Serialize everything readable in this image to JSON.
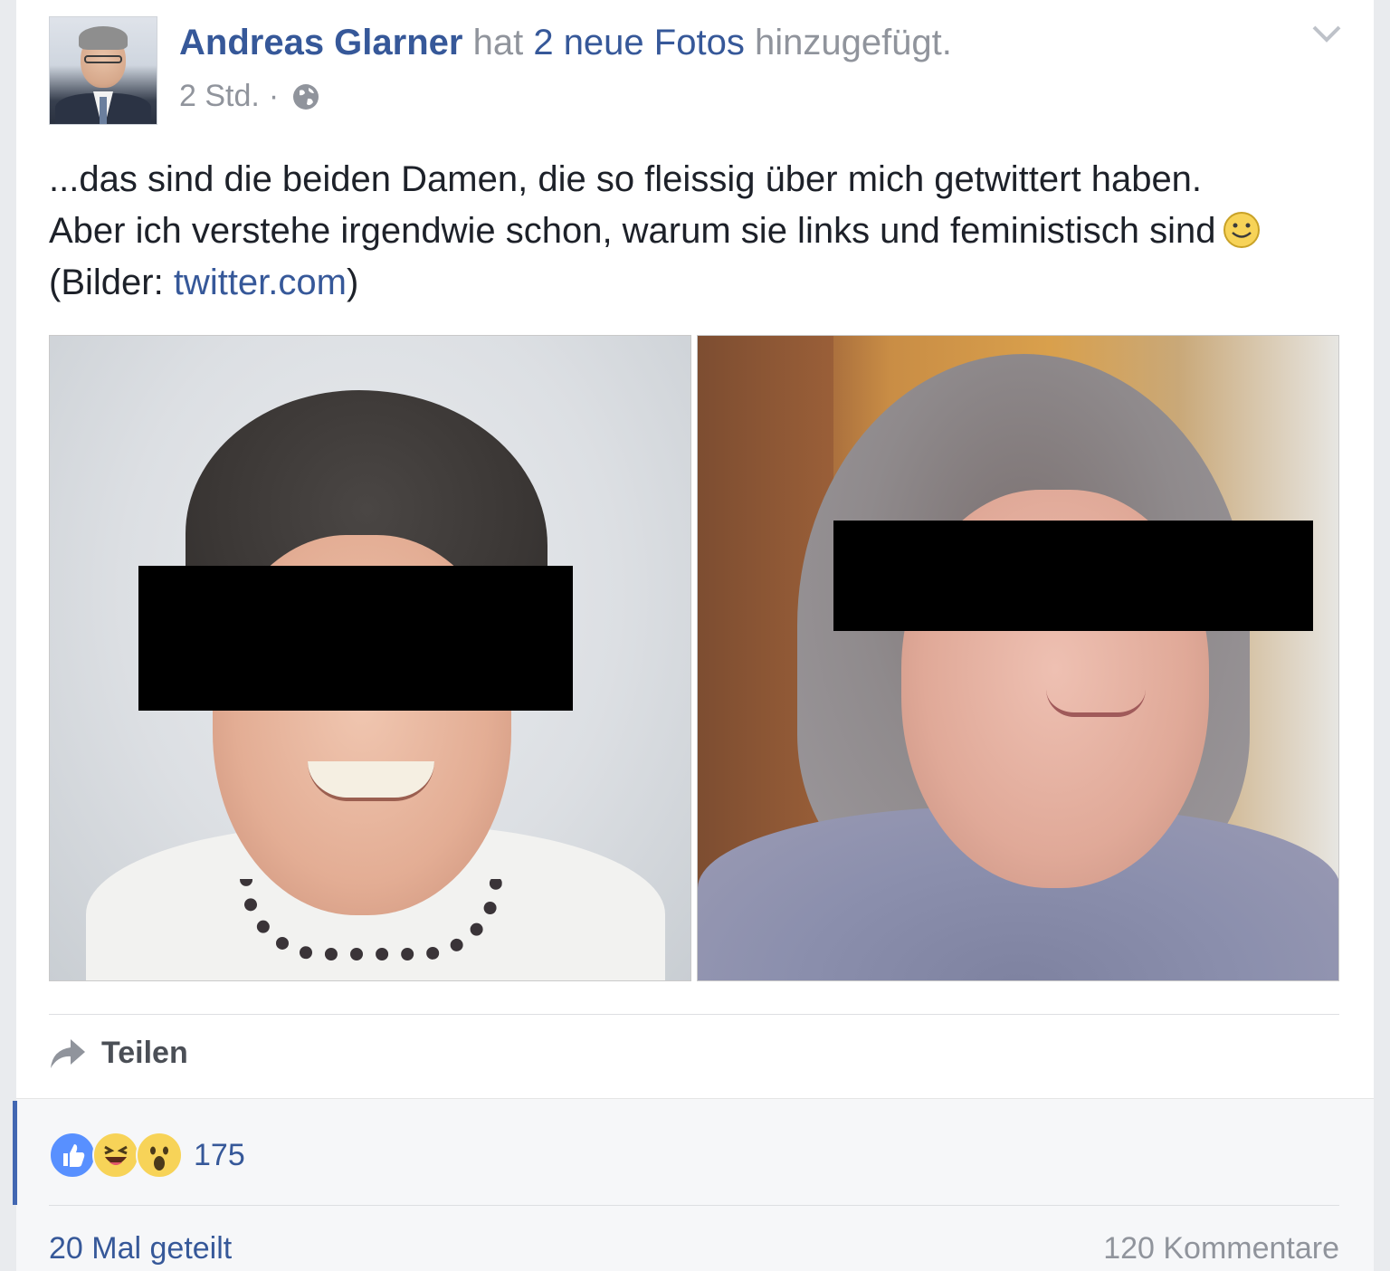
{
  "post": {
    "author": "Andreas Glarner",
    "action_prefix": "hat",
    "action_link": "2 neue Fotos",
    "action_suffix": "hinzugefügt.",
    "time": "2 Std.",
    "separator": "·",
    "privacy_icon": "globe-icon",
    "menu_icon": "chevron-down-icon",
    "text_line1": "...das sind die beiden Damen, die so fleissig über mich getwittert haben.",
    "text_line2": "Aber ich verstehe irgendwie schon, warum sie links und feministisch sind",
    "text_emoji": "smiley-emoji-icon",
    "text_line3_prefix": "(Bilder: ",
    "text_line3_link": "twitter.com",
    "text_line3_suffix": ")",
    "photos": [
      {
        "name": "photo-1",
        "content": "woman with short dark hair, eyes covered by black bar"
      },
      {
        "name": "photo-2",
        "content": "woman with long grey hair, eyes covered by black bar"
      }
    ]
  },
  "actions": {
    "share_label": "Teilen",
    "share_icon": "share-arrow-icon"
  },
  "footer": {
    "reactions": [
      "like-reaction-icon",
      "haha-reaction-icon",
      "wow-reaction-icon"
    ],
    "reaction_count": "175",
    "shares_label": "20 Mal geteilt",
    "comments_label": "120 Kommentare"
  },
  "colors": {
    "link": "#365899",
    "meta": "#90949c",
    "text": "#1d2129",
    "accent": "#4267b2",
    "like": "#5890ff",
    "emoji": "#f7d358"
  }
}
